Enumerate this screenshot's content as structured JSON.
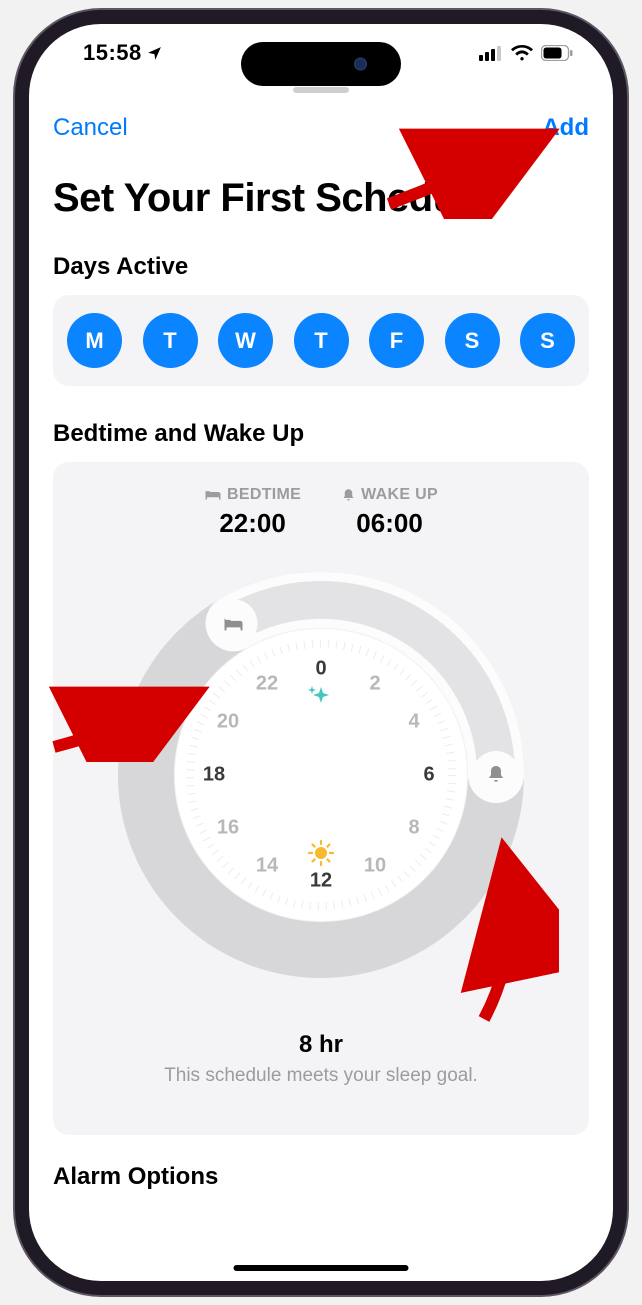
{
  "status": {
    "time": "15:58"
  },
  "nav": {
    "cancel": "Cancel",
    "add": "Add"
  },
  "title": "Set Your First Schedule",
  "days": {
    "heading": "Days Active",
    "items": [
      "M",
      "T",
      "W",
      "T",
      "F",
      "S",
      "S"
    ]
  },
  "sleep": {
    "heading": "Bedtime and Wake Up",
    "bedtime_label": "BEDTIME",
    "bedtime_value": "22:00",
    "wakeup_label": "WAKE UP",
    "wakeup_value": "06:00",
    "clock_hours": [
      "0",
      "2",
      "4",
      "6",
      "8",
      "10",
      "12",
      "14",
      "16",
      "18",
      "20",
      "22"
    ],
    "duration": "8 hr",
    "goal_message": "This schedule meets your sleep goal."
  },
  "alarm": {
    "heading": "Alarm Options"
  },
  "icons": {
    "bedtime": "bed-icon",
    "wakeup": "bell-icon",
    "midnight": "stars-icon",
    "noon": "sun-icon"
  },
  "colors": {
    "accent": "#007aff",
    "pill": "#0a84ff"
  }
}
